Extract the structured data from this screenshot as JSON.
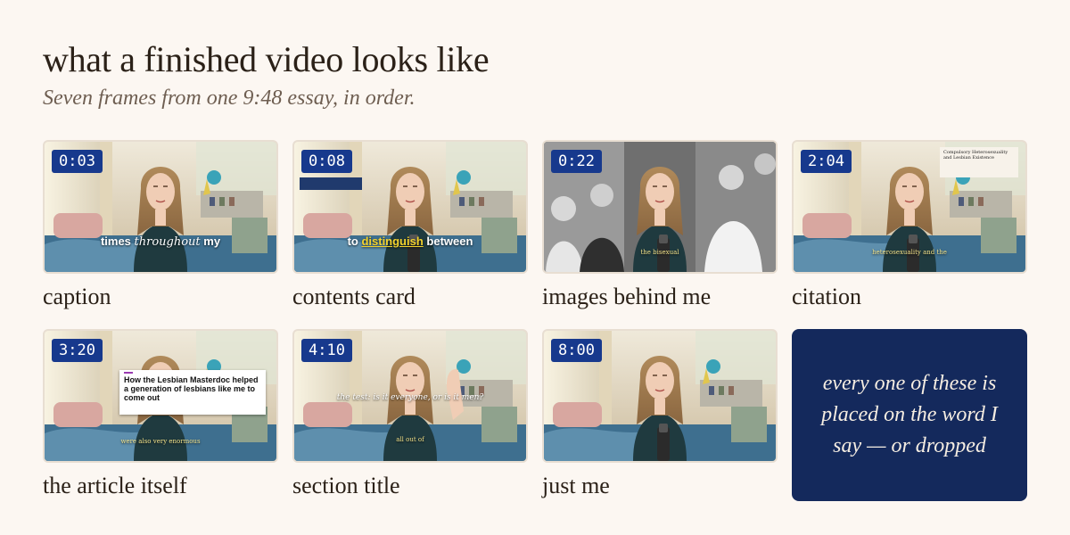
{
  "header": {
    "title": "what a finished video looks like",
    "subtitle": "Seven frames from one 9:48 essay, in order."
  },
  "frames": [
    {
      "timestamp": "0:03",
      "label": "caption",
      "caption_parts": [
        "times ",
        "throughout",
        " my"
      ]
    },
    {
      "timestamp": "0:08",
      "label": "contents card",
      "caption_parts": [
        "to ",
        "distinguish",
        " between"
      ]
    },
    {
      "timestamp": "0:22",
      "label": "images behind me",
      "caption": "the bisexual"
    },
    {
      "timestamp": "2:04",
      "label": "citation",
      "caption": "heterosexuality and the",
      "citation_title": "Compulsory Heterosexuality and Lesbian Existence"
    },
    {
      "timestamp": "3:20",
      "label": "the article itself",
      "caption": "were also very enormous",
      "article_headline": "How the Lesbian Masterdoc helped a generation of lesbians like me to come out"
    },
    {
      "timestamp": "4:10",
      "label": "section title",
      "caption": "all out of",
      "section_title": "the test: is it everyone, or is it men?"
    },
    {
      "timestamp": "8:00",
      "label": "just me"
    }
  ],
  "note": {
    "text": "every one of these is placed on the word I say — or dropped"
  },
  "colors": {
    "background": "#fcf7f2",
    "timestamp_badge": "#17398d",
    "note_card": "#14295c",
    "caption_highlight": "#f2d22e"
  }
}
